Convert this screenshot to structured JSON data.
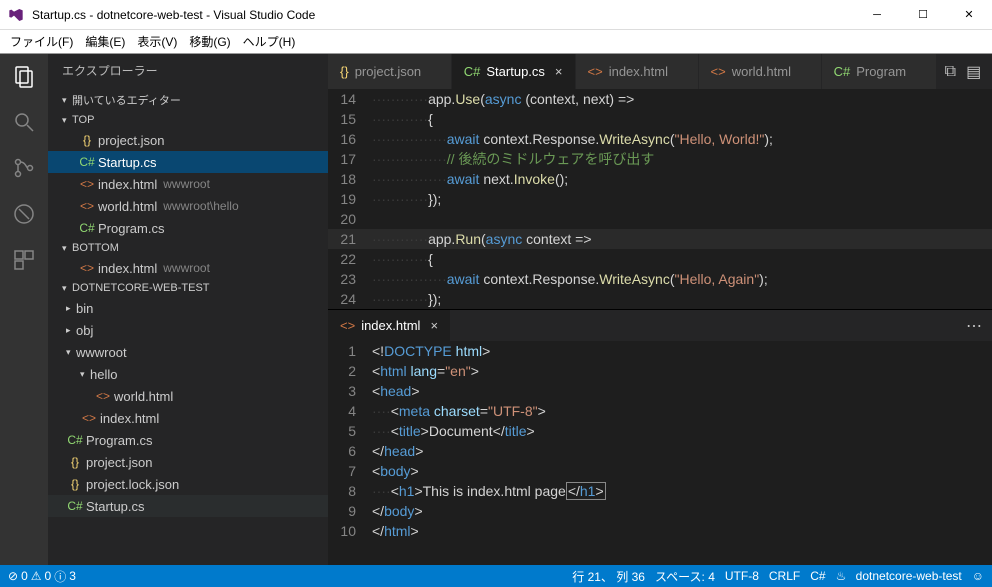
{
  "window": {
    "title": "Startup.cs - dotnetcore-web-test - Visual Studio Code"
  },
  "menu": [
    "ファイル(F)",
    "編集(E)",
    "表示(V)",
    "移動(G)",
    "ヘルプ(H)"
  ],
  "sidebar": {
    "title": "エクスプローラー",
    "sections": {
      "openEditors": "開いているエディター",
      "top": "TOP",
      "bottom": "BOTTOM",
      "project": "DOTNETCORE-WEB-TEST"
    },
    "top": [
      {
        "icon": "{}",
        "cls": "json",
        "name": "project.json"
      },
      {
        "icon": "C#",
        "cls": "csharp",
        "name": "Startup.cs",
        "active": true
      },
      {
        "icon": "<>",
        "cls": "htmlc",
        "name": "index.html",
        "desc": "wwwroot"
      },
      {
        "icon": "<>",
        "cls": "htmlc",
        "name": "world.html",
        "desc": "wwwroot\\hello"
      },
      {
        "icon": "C#",
        "cls": "csharp",
        "name": "Program.cs"
      }
    ],
    "bottom": [
      {
        "icon": "<>",
        "cls": "htmlc",
        "name": "index.html",
        "desc": "wwwroot"
      }
    ],
    "tree": [
      {
        "depth": 1,
        "tw": "▸",
        "name": "bin"
      },
      {
        "depth": 1,
        "tw": "▸",
        "name": "obj"
      },
      {
        "depth": 1,
        "tw": "▾",
        "name": "wwwroot"
      },
      {
        "depth": 2,
        "tw": "▾",
        "name": "hello"
      },
      {
        "depth": 3,
        "icon": "<>",
        "cls": "htmlc",
        "name": "world.html"
      },
      {
        "depth": 2,
        "icon": "<>",
        "cls": "htmlc",
        "name": "index.html"
      },
      {
        "depth": 1,
        "icon": "C#",
        "cls": "csharp",
        "name": "Program.cs"
      },
      {
        "depth": 1,
        "icon": "{}",
        "cls": "json",
        "name": "project.json"
      },
      {
        "depth": 1,
        "icon": "{}",
        "cls": "json",
        "name": "project.lock.json"
      },
      {
        "depth": 1,
        "icon": "C#",
        "cls": "csharp",
        "name": "Startup.cs",
        "hov": true
      }
    ]
  },
  "tabs": [
    {
      "icon": "{}",
      "cls": "json",
      "name": "project.json"
    },
    {
      "icon": "C#",
      "cls": "csharp",
      "name": "Startup.cs",
      "active": true
    },
    {
      "icon": "<>",
      "cls": "htmlc",
      "name": "index.html"
    },
    {
      "icon": "<>",
      "cls": "htmlc",
      "name": "world.html"
    },
    {
      "icon": "C#",
      "cls": "csharp",
      "name": "Program"
    }
  ],
  "subTab": {
    "icon": "<>",
    "cls": "htmlc",
    "name": "index.html"
  },
  "status": {
    "errors": "0",
    "warnings": "0",
    "info": "3",
    "linecol": "行 21、 列 36",
    "spaces": "スペース: 4",
    "encoding": "UTF-8",
    "eol": "CRLF",
    "lang": "C#",
    "live": "dotnetcore-web-test"
  }
}
